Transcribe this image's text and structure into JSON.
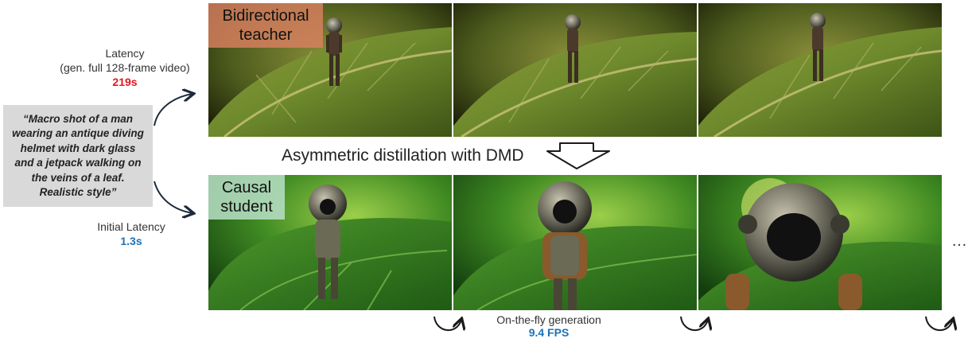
{
  "prompt": "“Macro shot of a man wearing an antique diving helmet with dark glass and a jetpack walking on the veins of a leaf. Realistic style”",
  "teacher": {
    "latency_label_line1": "Latency",
    "latency_label_line2": "(gen. full 128-frame video)",
    "latency_value": "219s",
    "badge_line1": "Bidirectional",
    "badge_line2": "teacher"
  },
  "student": {
    "latency_label": "Initial Latency",
    "latency_value": "1.3s",
    "badge_line1": "Causal",
    "badge_line2": "student"
  },
  "distillation_label": "Asymmetric distillation with DMD",
  "generation": {
    "label": "On-the-fly generation",
    "fps": "9.4 FPS"
  },
  "ellipsis": "…",
  "colors": {
    "latency_red": "#e8141c",
    "latency_blue": "#1a73b8",
    "prompt_bg": "#d9d9d9",
    "teacher_badge": "#d9805f",
    "student_badge": "#b9e0c8"
  }
}
